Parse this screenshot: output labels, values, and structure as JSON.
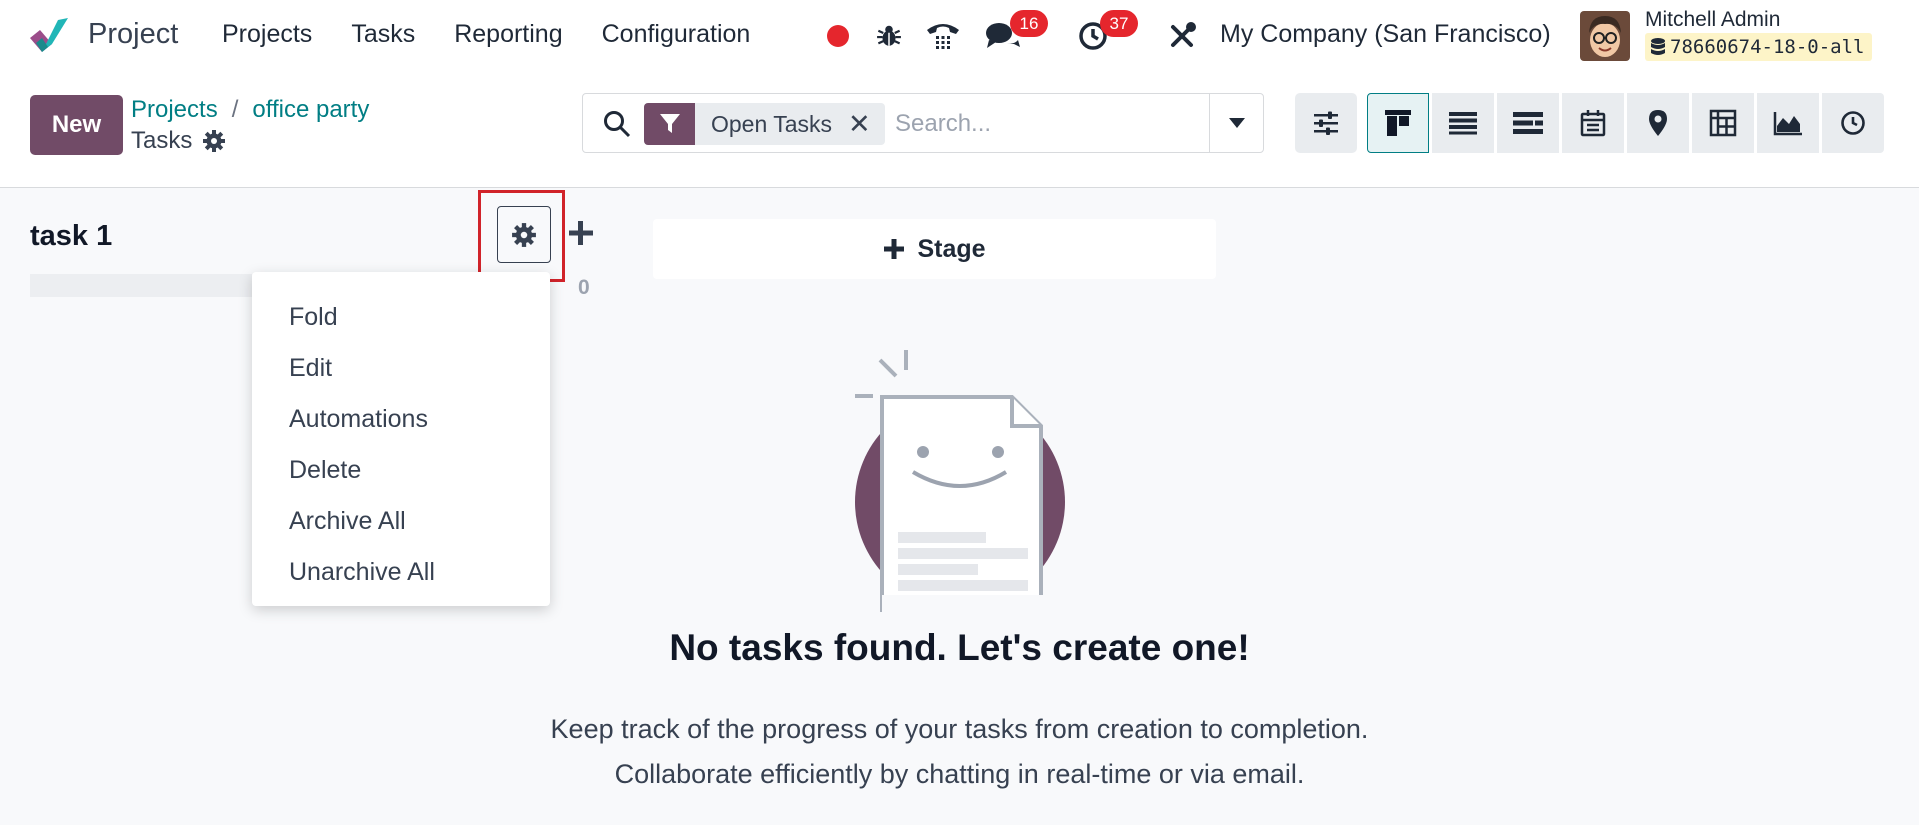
{
  "app": {
    "name": "Project"
  },
  "nav": {
    "menus": [
      "Projects",
      "Tasks",
      "Reporting",
      "Configuration"
    ],
    "messages_count": "16",
    "activities_count": "37",
    "company": "My Company (San Francisco)",
    "user_name": "Mitchell Admin",
    "database": "78660674-18-0-all"
  },
  "control_panel": {
    "new_label": "New",
    "breadcrumb": {
      "root": "Projects",
      "project": "office party",
      "current": "Tasks"
    },
    "search": {
      "facet": "Open Tasks",
      "placeholder": "Search..."
    }
  },
  "kanban": {
    "column_title": "task 1",
    "column_count": "0",
    "add_stage_label": "Stage",
    "column_menu": [
      "Fold",
      "Edit",
      "Automations",
      "Delete",
      "Archive All",
      "Unarchive All"
    ]
  },
  "empty_state": {
    "title": "No tasks found. Let's create one!",
    "line1": "Keep track of the progress of your tasks from creation to completion.",
    "line2": "Collaborate efficiently by chatting in real-time or via email."
  },
  "colors": {
    "brand": "#714b67",
    "link": "#017e84",
    "badge": "#e5262d",
    "highlight": "#d1232a"
  },
  "icons": {
    "recording": "record-dot-icon",
    "debug": "bug-icon",
    "voip": "phone-icon",
    "messages": "chat-icon",
    "activities": "clock-icon",
    "settings": "tools-icon"
  }
}
